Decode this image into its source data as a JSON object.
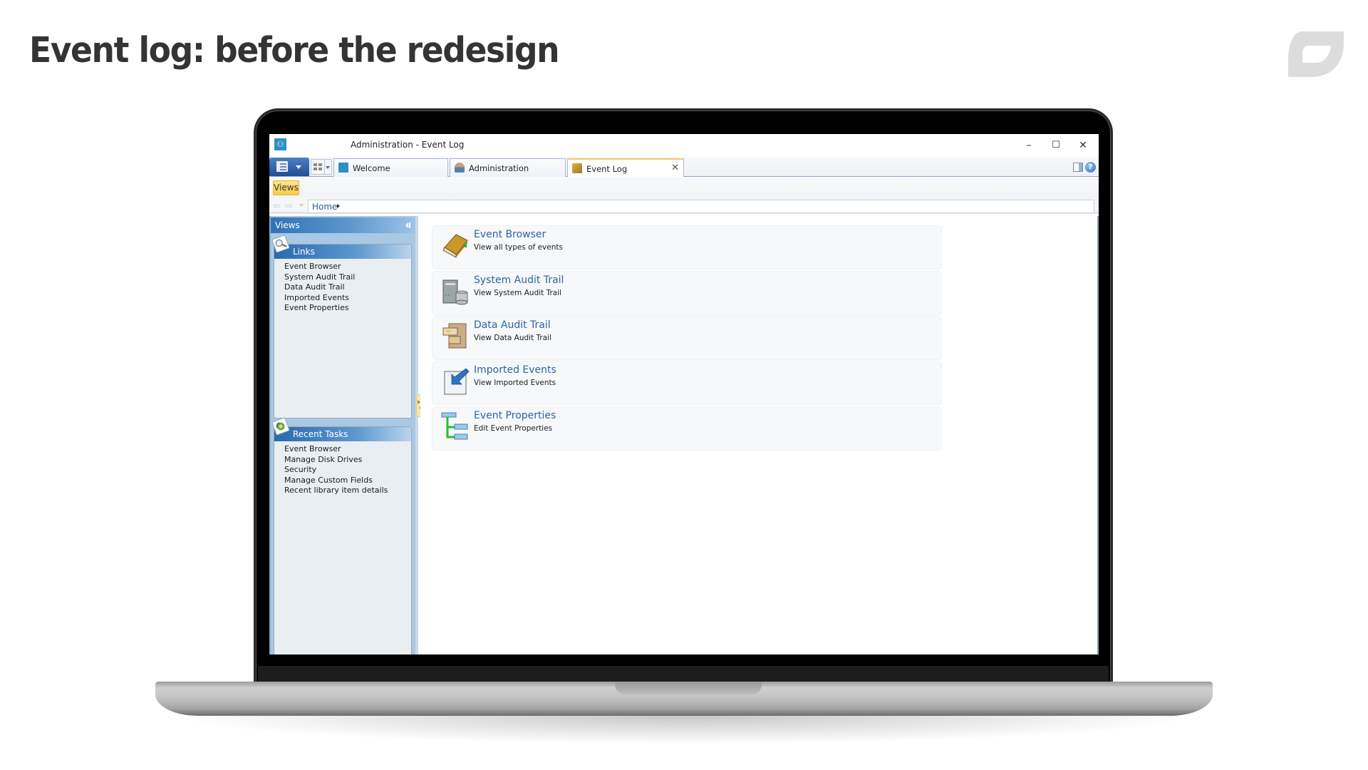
{
  "slide": {
    "title": "Event log: before the redesign"
  },
  "window": {
    "title": "Administration - Event Log",
    "controls": {
      "minimize": "–",
      "maximize": "☐",
      "close": "✕"
    }
  },
  "tabs": [
    {
      "label": "Welcome",
      "icon": "user-admin-icon",
      "active": false
    },
    {
      "label": "Administration",
      "icon": "administrator-icon",
      "active": false
    },
    {
      "label": "Event Log",
      "icon": "event-log-book-icon",
      "active": true,
      "close": "✕"
    }
  ],
  "ribbon": {
    "views_button": "Views"
  },
  "navigation": {
    "back": "⇦",
    "forward": "⇨",
    "breadcrumb": [
      "Home"
    ]
  },
  "sidebar": {
    "header": "Views",
    "panels": [
      {
        "title": "Links",
        "icon": "magnifier-icon",
        "items": [
          "Event Browser",
          "System Audit Trail",
          "Data Audit Trail",
          "Imported Events",
          "Event Properties"
        ]
      },
      {
        "title": "Recent Tasks",
        "icon": "recent-tasks-icon",
        "items": [
          "Event Browser",
          "Manage Disk Drives",
          "Security",
          "Manage Custom Fields",
          "Recent library item details"
        ]
      }
    ]
  },
  "content": {
    "items": [
      {
        "title": "Event Browser",
        "description": "View all types of events",
        "icon": "book-icon"
      },
      {
        "title": "System Audit Trail",
        "description": "View System Audit Trail",
        "icon": "server-database-icon"
      },
      {
        "title": "Data Audit Trail",
        "description": "View Data Audit Trail",
        "icon": "file-cabinet-icon"
      },
      {
        "title": "Imported Events",
        "description": "View Imported Events",
        "icon": "import-arrow-icon"
      },
      {
        "title": "Event Properties",
        "description": "Edit Event Properties",
        "icon": "tree-properties-icon"
      }
    ]
  },
  "colors": {
    "accent_blue": "#2d64a6",
    "views_button": "#f8cc48",
    "sidebar_header": "#2f73b5",
    "title_text": "#333535"
  }
}
